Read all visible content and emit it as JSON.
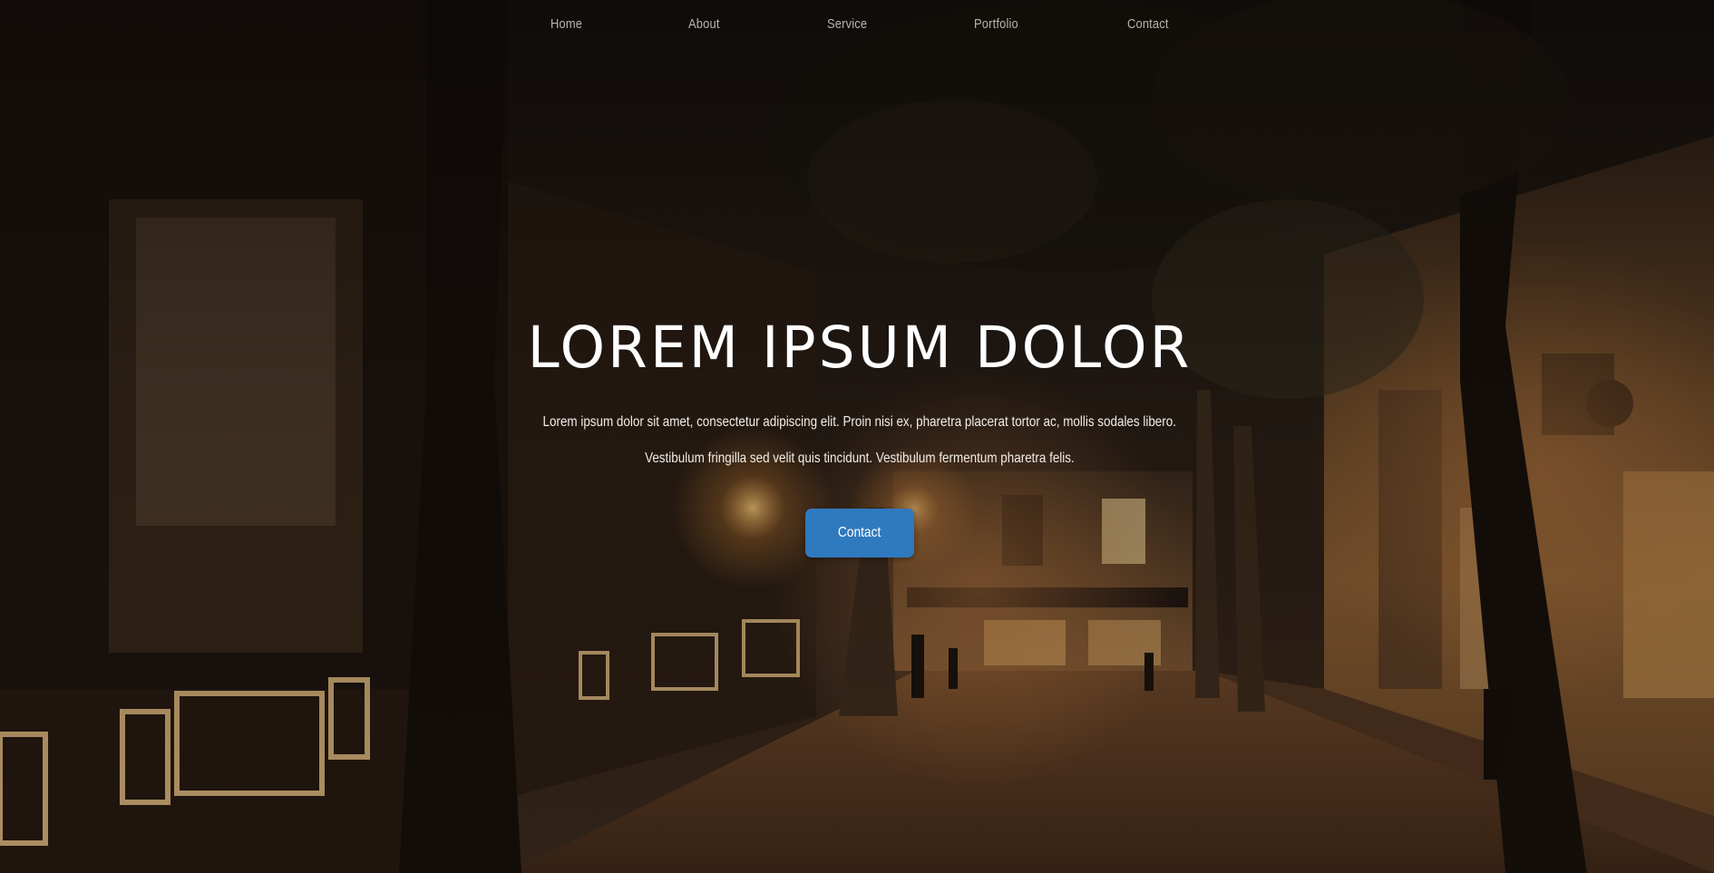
{
  "nav": {
    "items": [
      {
        "label": "Home"
      },
      {
        "label": "About"
      },
      {
        "label": "Service"
      },
      {
        "label": "Portfolio"
      },
      {
        "label": "Contact"
      }
    ]
  },
  "hero": {
    "title": "LOREM IPSUM DOLOR",
    "description_line1": "Lorem ipsum dolor sit amet, consectetur adipiscing elit. Proin nisi ex, pharetra placerat tortor ac, mollis sodales libero.",
    "description_line2": "Vestibulum fringilla sed velit quis tincidunt. Vestibulum fermentum pharetra felis.",
    "cta_label": "Contact",
    "background": "night-street-photo",
    "accent_color": "#2f79be"
  }
}
